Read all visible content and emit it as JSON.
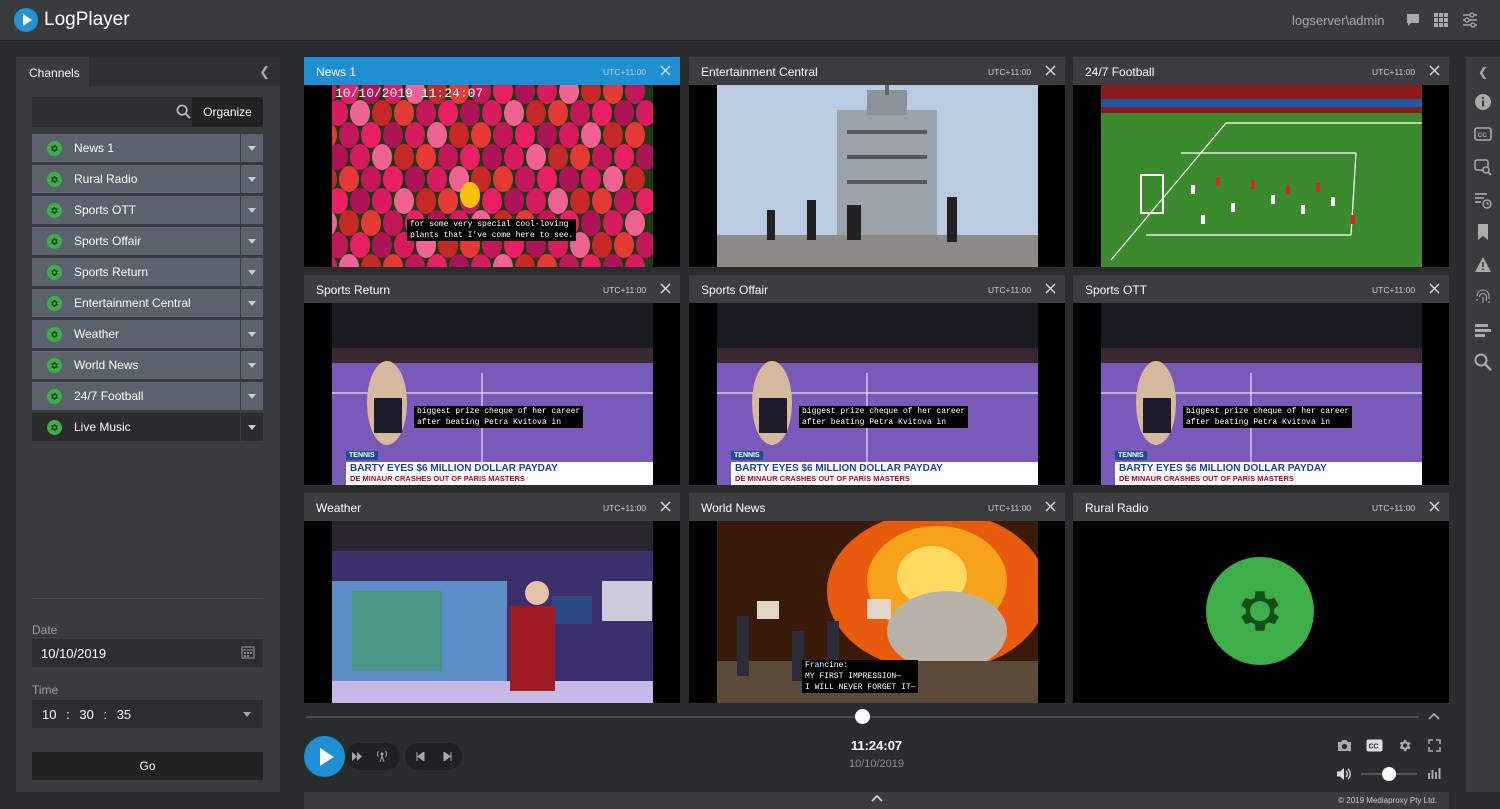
{
  "app": {
    "title": "LogPlayer",
    "user": "logserver\\admin"
  },
  "left_panel": {
    "tab": "Channels",
    "search_placeholder": "",
    "organize_label": "Organize",
    "channels": [
      {
        "name": "News 1"
      },
      {
        "name": "Rural Radio"
      },
      {
        "name": "Sports OTT"
      },
      {
        "name": "Sports Offair"
      },
      {
        "name": "Sports Return"
      },
      {
        "name": "Entertainment Central"
      },
      {
        "name": "Weather"
      },
      {
        "name": "World News"
      },
      {
        "name": "24/7 Football"
      },
      {
        "name": "Live Music"
      }
    ],
    "date_label": "Date",
    "date_value": "10/10/2019",
    "time_label": "Time",
    "time": {
      "h": "10",
      "m": "30",
      "s": "35"
    },
    "go_label": "Go"
  },
  "tiles": [
    {
      "title": "News 1",
      "tz": "UTC+11:00",
      "overlay_timestamp": "10/10/2019 11:24:07",
      "caption": "for some very special cool-loving\nplants that I've come here to see."
    },
    {
      "title": "Entertainment Central",
      "tz": "UTC+11:00"
    },
    {
      "title": "24/7 Football",
      "tz": "UTC+11:00"
    },
    {
      "title": "Sports Return",
      "tz": "UTC+11:00",
      "caption": "biggest prize cheque of her career\nafter beating Petra Kvitova in",
      "banner_tag": "TENNIS",
      "banner_head": "BARTY EYES $6 MILLION DOLLAR PAYDAY",
      "banner_sub": "DE MINAUR CRASHES OUT OF PARIS MASTERS"
    },
    {
      "title": "Sports Offair",
      "tz": "UTC+11:00",
      "caption": "biggest prize cheque of her career\nafter beating Petra Kvitova in",
      "banner_tag": "TENNIS",
      "banner_head": "BARTY EYES $6 MILLION DOLLAR PAYDAY",
      "banner_sub": "DE MINAUR CRASHES OUT OF PARIS MASTERS"
    },
    {
      "title": "Sports OTT",
      "tz": "UTC+11:00",
      "caption": "biggest prize cheque of her career\nafter beating Petra Kvitova in",
      "banner_tag": "TENNIS",
      "banner_head": "BARTY EYES $6 MILLION DOLLAR PAYDAY",
      "banner_sub": "DE MINAUR CRASHES OUT OF PARIS MASTERS"
    },
    {
      "title": "Weather",
      "tz": "UTC+11:00"
    },
    {
      "title": "World News",
      "tz": "UTC+11:00",
      "caption": "Francine:\nMY FIRST IMPRESSION—\nI WILL NEVER FORGET IT—"
    },
    {
      "title": "Rural Radio",
      "tz": "UTC+11:00"
    }
  ],
  "player": {
    "time": "11:24:07",
    "date": "10/10/2019",
    "scrub_position": 0.5,
    "volume": 0.5
  },
  "footer": {
    "copyright": "© 2019 Mediaproxy Pty Ltd."
  },
  "colors": {
    "accent": "#1f8fd4",
    "channel_status": "#3dae49",
    "panel": "#3a3b3d"
  },
  "icons": {
    "right_sidebar": [
      "info-icon",
      "closed-captions-icon",
      "caption-search-icon",
      "playlist-clock-icon",
      "bookmark-icon",
      "warning-icon",
      "fingerprint-icon",
      "segments-icon",
      "search-icon"
    ],
    "top": [
      "chat-icon",
      "grid-icon",
      "settings-sliders-icon"
    ]
  }
}
